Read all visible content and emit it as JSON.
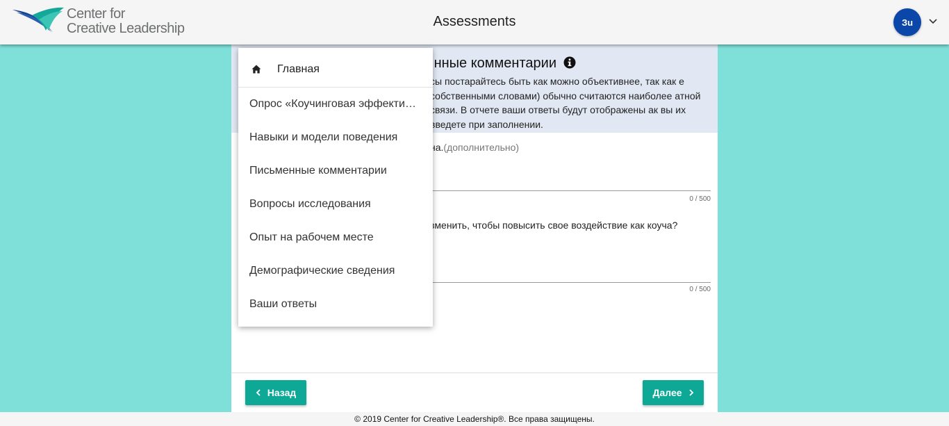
{
  "header": {
    "logo_line1": "Center for",
    "logo_line2": "Creative Leadership",
    "title": "Assessments",
    "avatar_initials": "Зu"
  },
  "intro": {
    "title": "нные комментарии",
    "text": "сы постарайтесь быть как можно объективнее, так как е собственными словами) обычно считаются наиболее атной связи. В отчете ваши ответы будут отображены ак вы их введете при заполнении."
  },
  "question1": {
    "text": "на.",
    "optional": "(дополнительно)",
    "counter": "0 / 500"
  },
  "question2": {
    "text": "зменить, чтобы повысить свое воздействие как коуча?",
    "counter": "0 / 500"
  },
  "menu": {
    "home_label": "Главная",
    "items": [
      "Опрос «Коучинговая эффекти…",
      "Навыки и модели поведения",
      "Письменные комментарии",
      "Вопросы исследования",
      "Опыт на рабочем месте",
      "Демографические сведения",
      "Ваши ответы"
    ]
  },
  "nav": {
    "back_label": "Назад",
    "next_label": "Далее"
  },
  "footer": {
    "copyright": "© 2019 Center for Creative Leadership®. Все права защищены."
  },
  "colors": {
    "page_bg": "#7fe0d9",
    "accent_button": "#0ea896",
    "avatar_bg": "#0a47a9",
    "intro_bg": "#e2e8f3"
  }
}
